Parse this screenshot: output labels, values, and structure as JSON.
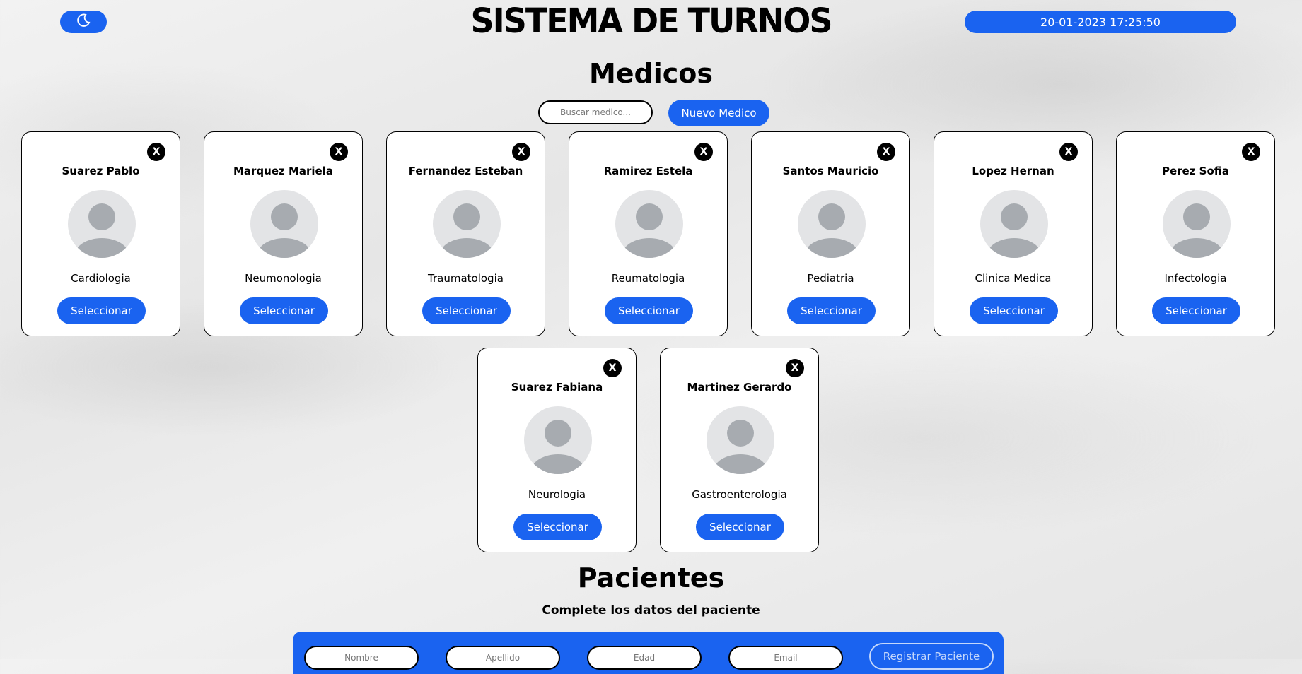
{
  "header": {
    "title": "SISTEMA DE TURNOS",
    "datetime": "20-01-2023 17:25:50",
    "theme_toggle_icon": "moon-icon"
  },
  "medicos": {
    "title": "Medicos",
    "search_placeholder": "Buscar medico...",
    "new_button": "Nuevo Medico",
    "close_label": "X",
    "select_label": "Seleccionar",
    "cards": [
      {
        "name": "Suarez Pablo",
        "specialty": "Cardiologia"
      },
      {
        "name": "Marquez Mariela",
        "specialty": "Neumonologia"
      },
      {
        "name": "Fernandez Esteban",
        "specialty": "Traumatologia"
      },
      {
        "name": "Ramirez Estela",
        "specialty": "Reumatologia"
      },
      {
        "name": "Santos Mauricio",
        "specialty": "Pediatria"
      },
      {
        "name": "Lopez Hernan",
        "specialty": "Clinica Medica"
      },
      {
        "name": "Perez Sofia",
        "specialty": "Infectologia"
      },
      {
        "name": "Suarez Fabiana",
        "specialty": "Neurologia"
      },
      {
        "name": "Martinez Gerardo",
        "specialty": "Gastroenterologia"
      }
    ]
  },
  "pacientes": {
    "title": "Pacientes",
    "subtitle": "Complete los datos del paciente",
    "fields": {
      "nombre_placeholder": "Nombre",
      "apellido_placeholder": "Apellido",
      "edad_placeholder": "Edad",
      "email_placeholder": "Email"
    },
    "register_button": "Registrar Paciente"
  },
  "colors": {
    "accent": "#1a63f0",
    "card_bg": "#ffffff",
    "close_bg": "#000000"
  }
}
